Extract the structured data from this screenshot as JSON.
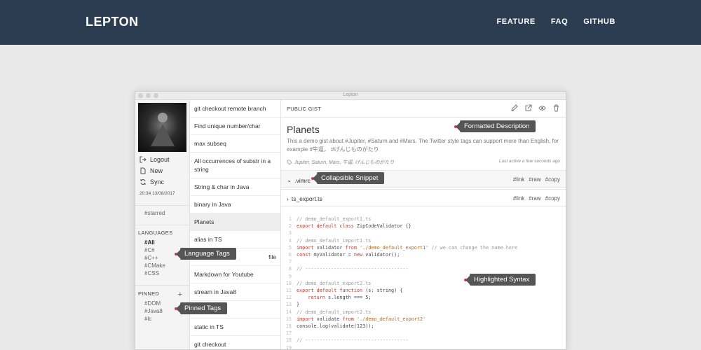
{
  "site": {
    "brand": "LEPTON",
    "nav": [
      "FEATURE",
      "FAQ",
      "GITHUB"
    ]
  },
  "window": {
    "title": "Lepton"
  },
  "sidebar": {
    "actions": [
      {
        "label": "Logout",
        "icon": "logout-icon"
      },
      {
        "label": "New",
        "icon": "new-file-icon"
      },
      {
        "label": "Sync",
        "icon": "sync-icon"
      }
    ],
    "timestamp": "20:34 13/08/2017",
    "starred": "#starred",
    "languages_heading": "LANGUAGES",
    "languages": [
      "#All",
      "#C#",
      "#C++",
      "#CMake",
      "#CSS"
    ],
    "pinned_heading": "PINNED",
    "pinned_add": "+",
    "pinned": [
      "#DOM",
      "#Java8",
      "#lc"
    ]
  },
  "gists": [
    "git checkout remote branch",
    "Find unique number/char",
    "max subseq",
    "All occurrences of substr in a string",
    "String & char in Java",
    "binary in Java",
    "Planets",
    "alias in TS",
    "file",
    "Markdown for Youtube",
    "stream in Java8",
    "",
    "static in TS",
    "git checkout"
  ],
  "detail": {
    "visibility": "PUBLIC GIST",
    "title": "Planets",
    "description": "This a demo gist about #Jupiter, #Saturn and #Mars. The Twitter style tags can support more than English, for example #牛逼，  #げんじものがたり",
    "tags": "Jupiter, Saturn, Mars, 牛逼, げんじものがたり",
    "last_active": "Last active a few seconds ago",
    "header_icons": [
      "edit-icon",
      "open-external-icon",
      "eye-icon",
      "trash-icon"
    ]
  },
  "snippets": [
    {
      "name": ".vimrc",
      "chevron": "⌄",
      "actions": [
        "#link",
        "#raw",
        "#copy"
      ]
    },
    {
      "name": "ts_export.ts",
      "chevron": "›",
      "actions": [
        "#link",
        "#raw",
        "#copy"
      ]
    }
  ],
  "code": [
    {
      "n": "1",
      "parts": [
        {
          "t": "// demo_default_export1.ts",
          "c": "c-comment"
        }
      ]
    },
    {
      "n": "2",
      "parts": [
        {
          "t": "export default class",
          "c": "c-kw"
        },
        {
          "t": " ZipCodeValidator {}",
          "c": ""
        }
      ]
    },
    {
      "n": "3",
      "parts": []
    },
    {
      "n": "4",
      "parts": [
        {
          "t": "// demo_default_import1.ts",
          "c": "c-comment"
        }
      ]
    },
    {
      "n": "5",
      "parts": [
        {
          "t": "import",
          "c": "c-kw"
        },
        {
          "t": " validator ",
          "c": ""
        },
        {
          "t": "from",
          "c": "c-kw"
        },
        {
          "t": " './demo_default_export1'",
          "c": "c-str"
        },
        {
          "t": " // we can change the name here",
          "c": "c-comment"
        }
      ]
    },
    {
      "n": "6",
      "parts": [
        {
          "t": "const",
          "c": "c-kw"
        },
        {
          "t": " myValidator = ",
          "c": ""
        },
        {
          "t": "new",
          "c": "c-kw"
        },
        {
          "t": " validator();",
          "c": ""
        }
      ]
    },
    {
      "n": "7",
      "parts": []
    },
    {
      "n": "8",
      "parts": [
        {
          "t": "// ------------------------------------",
          "c": "c-comment"
        }
      ]
    },
    {
      "n": "9",
      "parts": []
    },
    {
      "n": "10",
      "parts": [
        {
          "t": "// demo_default_export2.ts",
          "c": "c-comment"
        }
      ]
    },
    {
      "n": "11",
      "parts": [
        {
          "t": "export default function",
          "c": "c-kw"
        },
        {
          "t": " (s: string) {",
          "c": ""
        }
      ]
    },
    {
      "n": "12",
      "parts": [
        {
          "t": "    ",
          "c": ""
        },
        {
          "t": "return",
          "c": "c-kw"
        },
        {
          "t": " s.length === 5;",
          "c": ""
        }
      ]
    },
    {
      "n": "13",
      "parts": [
        {
          "t": "}",
          "c": ""
        }
      ]
    },
    {
      "n": "14",
      "parts": [
        {
          "t": "// demo_default_import2.ts",
          "c": "c-comment"
        }
      ]
    },
    {
      "n": "15",
      "parts": [
        {
          "t": "import",
          "c": "c-kw"
        },
        {
          "t": " validate ",
          "c": ""
        },
        {
          "t": "from",
          "c": "c-kw"
        },
        {
          "t": " './demo_default_export2'",
          "c": "c-str"
        }
      ]
    },
    {
      "n": "16",
      "parts": [
        {
          "t": "console.log(validate(123));",
          "c": ""
        }
      ]
    },
    {
      "n": "17",
      "parts": []
    },
    {
      "n": "18",
      "parts": [
        {
          "t": "// ------------------------------------",
          "c": "c-comment"
        }
      ]
    },
    {
      "n": "19",
      "parts": []
    },
    {
      "n": "20",
      "parts": [
        {
          "t": "// demo_default_export3.ts",
          "c": "c-comment"
        }
      ]
    }
  ],
  "callouts": {
    "formatted_description": "Formatted Description",
    "collapsible_snippet": "Collapsible Snippet",
    "language_tags": "Language Tags",
    "highlighted_syntax": "Highlighted Syntax",
    "pinned_tags": "Pinned Tags"
  },
  "colors": {
    "nav_bg": "#2c3d52",
    "page_bg": "#e9e9e9",
    "callout_bg": "#555555",
    "callout_dot": "#e0306b",
    "keyword": "#c0392b"
  }
}
